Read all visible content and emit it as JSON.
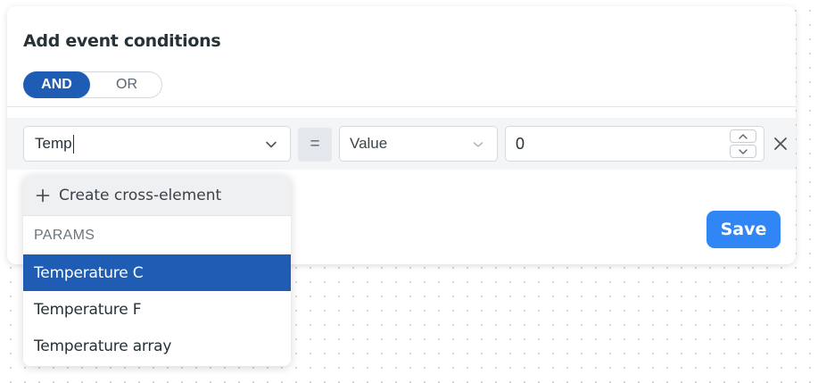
{
  "panel": {
    "title": "Add event conditions",
    "logic_toggle": {
      "options": [
        "AND",
        "OR"
      ],
      "selected": "AND"
    },
    "save_label": "Save"
  },
  "condition_row": {
    "param_input_value": "Temp",
    "operator": "=",
    "value_type": "Value",
    "value": "0"
  },
  "dropdown": {
    "create_label": "Create cross-element",
    "section_header": "PARAMS",
    "items": [
      {
        "label": "Temperature C",
        "selected": true
      },
      {
        "label": "Temperature F",
        "selected": false
      },
      {
        "label": "Temperature array",
        "selected": false
      }
    ]
  },
  "colors": {
    "accent_dark": "#1e5db3",
    "save_button": "#2f86f4",
    "row_band": "#f3f5f7"
  },
  "icons": {
    "param_select": "chevron-down-icon",
    "value_type_select": "chevron-down-icon",
    "stepper_up": "chevron-up-icon",
    "stepper_down": "chevron-down-icon",
    "remove": "close-icon",
    "create": "plus-icon"
  }
}
